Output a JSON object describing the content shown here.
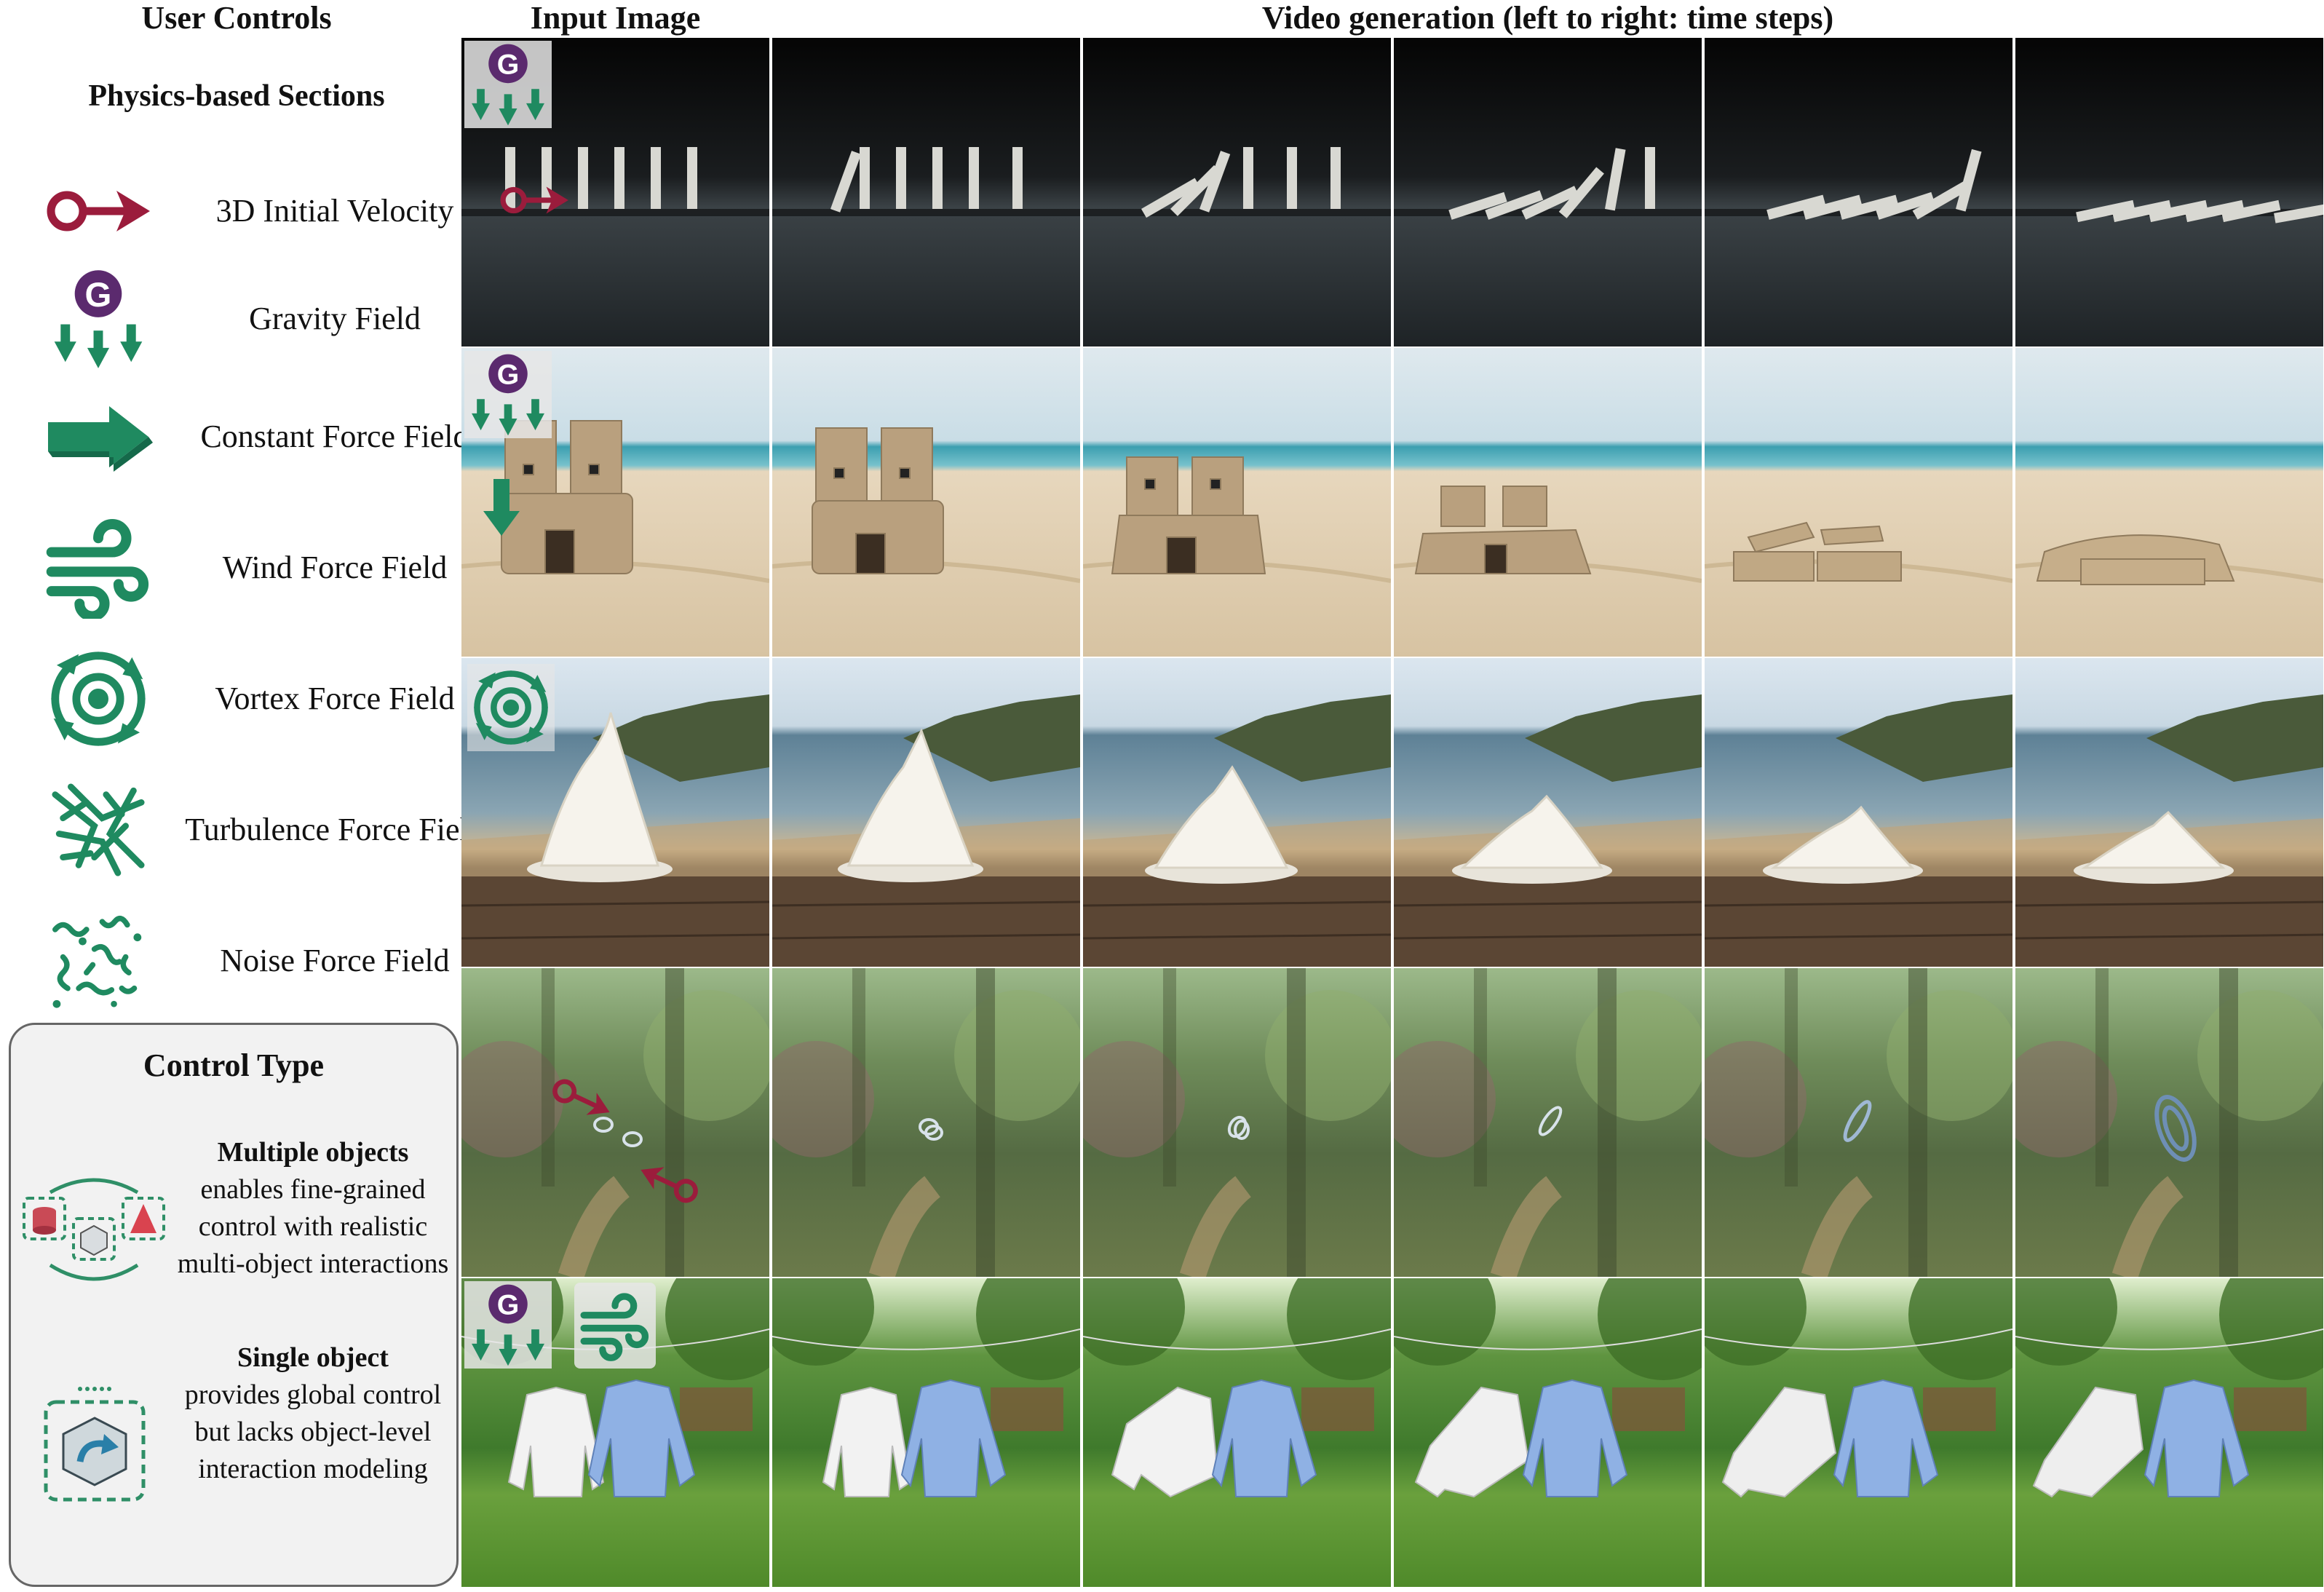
{
  "headers": {
    "user_controls": "User Controls",
    "input_image": "Input Image",
    "video_generation": "Video generation (left to right: time steps)"
  },
  "left_panel": {
    "section_title": "Physics-based Sections",
    "items": [
      {
        "icon": "initial-velocity-icon",
        "label": "3D Initial Velocity"
      },
      {
        "icon": "gravity-icon",
        "label": "Gravity Field"
      },
      {
        "icon": "constant-force-icon",
        "label": "Constant Force Field"
      },
      {
        "icon": "wind-icon",
        "label": "Wind Force Field"
      },
      {
        "icon": "vortex-icon",
        "label": "Vortex Force Field"
      },
      {
        "icon": "turbulence-icon",
        "label": "Turbulence Force Field"
      },
      {
        "icon": "noise-icon",
        "label": "Noise Force Field"
      }
    ]
  },
  "control_type": {
    "title": "Control Type",
    "multiple": {
      "heading": "Multiple objects",
      "text": "enables fine-grained control with realistic multi-object interactions"
    },
    "single": {
      "heading": "Single object",
      "text": "provides global control but lacks object-level interaction modeling"
    }
  },
  "rows": [
    {
      "scene": "dominoes",
      "controls": [
        "gravity-icon",
        "initial-velocity-icon"
      ]
    },
    {
      "scene": "sandcastle",
      "controls": [
        "gravity-icon",
        "constant-force-icon"
      ]
    },
    {
      "scene": "whipped-cream",
      "controls": [
        "vortex-icon"
      ]
    },
    {
      "scene": "glass-rings",
      "controls": [
        "initial-velocity-icon",
        "initial-velocity-icon"
      ]
    },
    {
      "scene": "shirts",
      "controls": [
        "gravity-icon",
        "wind-icon"
      ]
    }
  ],
  "frames_per_row": 6,
  "colors": {
    "velocity": "#9b1c3c",
    "gravity_badge": "#5b2a6e",
    "force_green": "#1f8a60"
  }
}
